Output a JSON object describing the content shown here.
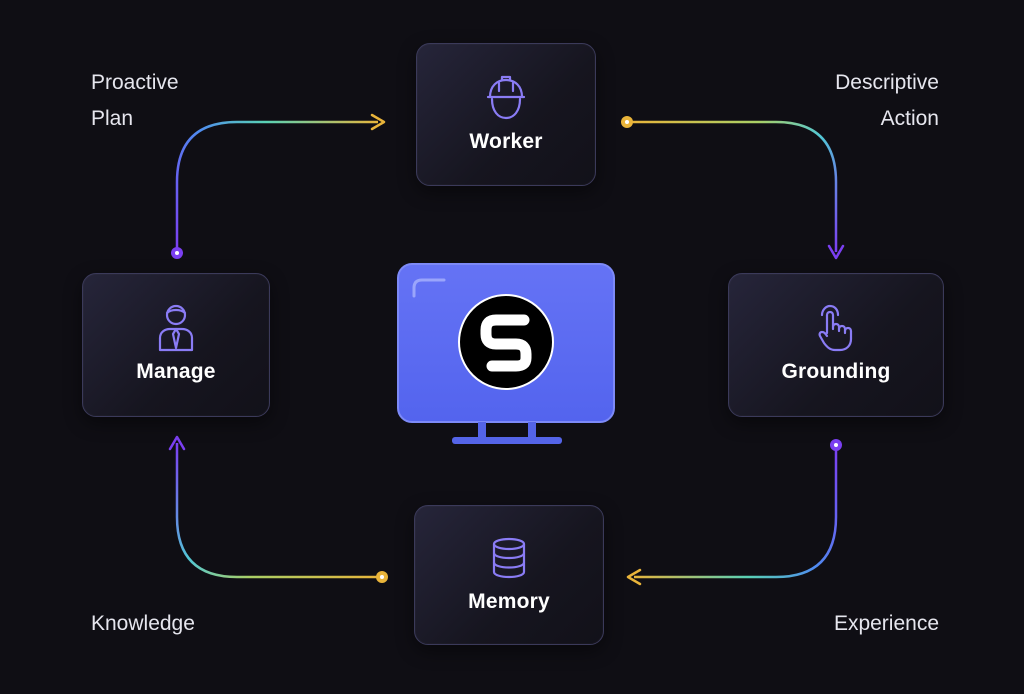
{
  "nodes": {
    "worker": {
      "label": "Worker",
      "icon": "hard-hat-worker-icon"
    },
    "manage": {
      "label": "Manage",
      "icon": "manager-person-icon"
    },
    "grounding": {
      "label": "Grounding",
      "icon": "pointing-hand-icon"
    },
    "memory": {
      "label": "Memory",
      "icon": "database-icon"
    }
  },
  "center": {
    "icon": "monitor-with-s-logo-icon",
    "logo_letter": "S"
  },
  "edges": {
    "proactive_plan": {
      "line1": "Proactive",
      "line2": "Plan"
    },
    "descriptive_action": {
      "line1": "Descriptive",
      "line2": "Action"
    },
    "knowledge": {
      "text": "Knowledge"
    },
    "experience": {
      "text": "Experience"
    }
  },
  "colors": {
    "background": "#0f0e14",
    "accent_purple": "#7b3ff2",
    "accent_yellow": "#e9b43a",
    "accent_teal": "#52d3c3",
    "icon_purple": "#8a7cf5",
    "monitor_blue": "#5d6cf2"
  }
}
